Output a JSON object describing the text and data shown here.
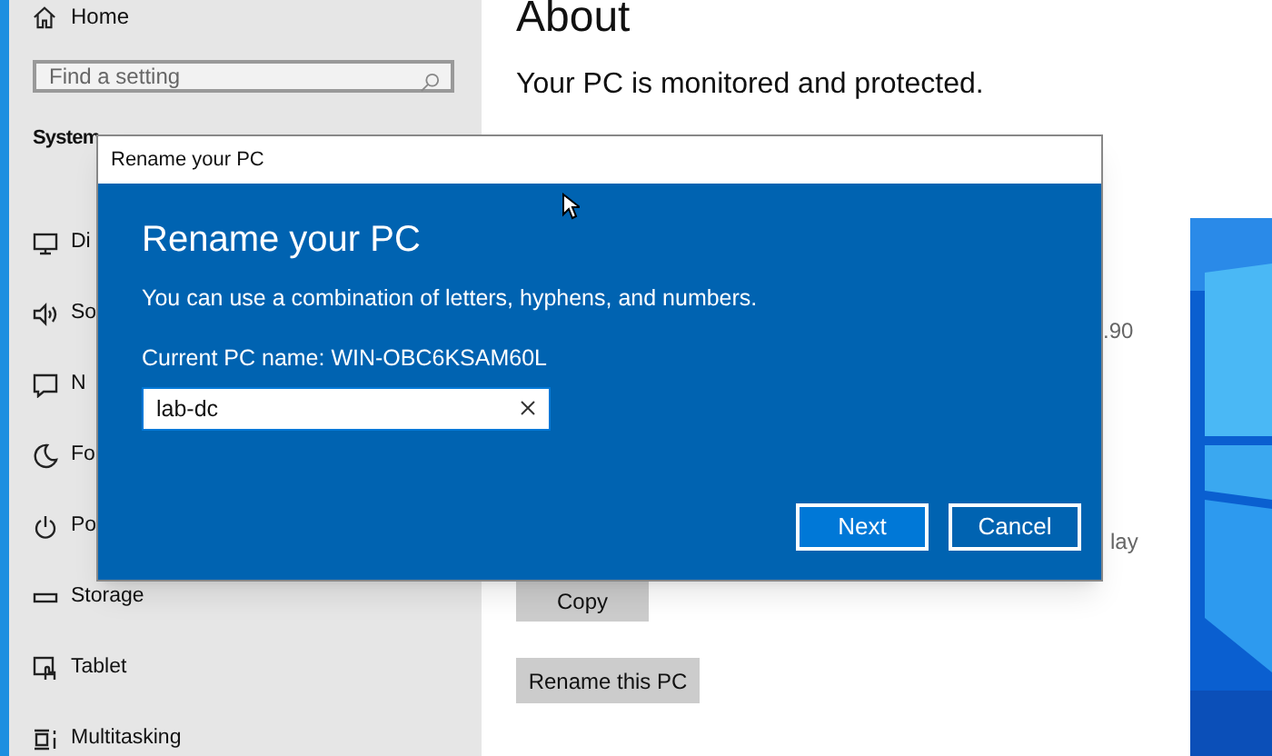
{
  "sidebar": {
    "home": "Home",
    "search": {
      "placeholder": "Find a setting"
    },
    "section": "System",
    "items": [
      {
        "label": "Di"
      },
      {
        "label": "So"
      },
      {
        "label": "N"
      },
      {
        "label": "Fo"
      },
      {
        "label": "Po"
      },
      {
        "label": "Storage"
      },
      {
        "label": "Tablet"
      },
      {
        "label": "Multitasking"
      }
    ]
  },
  "main": {
    "title": "About",
    "status": "Your PC is monitored and protected.",
    "fragment_1": ".90",
    "fragment_2": "lay",
    "copy_button": "Copy",
    "rename_button": "Rename this PC"
  },
  "dialog": {
    "window_title": "Rename your PC",
    "heading": "Rename your PC",
    "description": "You can use a combination of letters, hyphens, and numbers.",
    "current_name": "Current PC name: WIN-OBC6KSAM60L",
    "value": "lab-dc",
    "buttons": [
      {
        "label": "Next",
        "primary": true
      },
      {
        "label": "Cancel",
        "primary": false
      }
    ]
  }
}
